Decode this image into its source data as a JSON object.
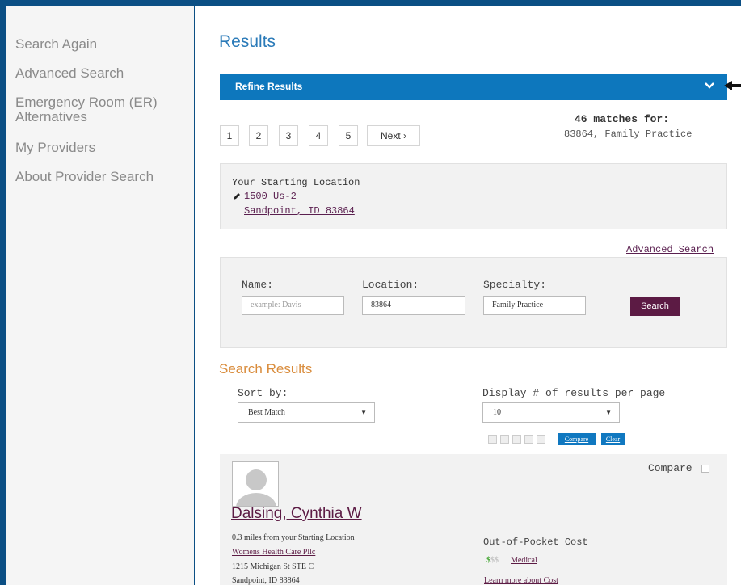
{
  "sidebar": {
    "items": [
      {
        "label": "Search Again"
      },
      {
        "label": "Advanced Search"
      },
      {
        "label_line1": "Emergency Room (ER)",
        "label_line2": "Alternatives"
      },
      {
        "label": "My Providers"
      },
      {
        "label": "About Provider Search"
      }
    ]
  },
  "header": {
    "title": "Results"
  },
  "refine": {
    "label": "Refine Results"
  },
  "pagination": {
    "pages": [
      "1",
      "2",
      "3",
      "4",
      "5"
    ],
    "next_label": "Next ›"
  },
  "matches": {
    "heading": "46 matches for:",
    "query": "83864, Family Practice"
  },
  "starting_location": {
    "label": "Your Starting Location",
    "address_line1": "1500 Us-2",
    "address_line2": "Sandpoint, ID 83864"
  },
  "advanced_search_link": "Advanced Search",
  "search_form": {
    "name_label": "Name:",
    "name_placeholder": "example: Davis",
    "location_label": "Location:",
    "location_value": "83864",
    "specialty_label": "Specialty:",
    "specialty_value": "Family Practice",
    "search_button": "Search"
  },
  "search_results": {
    "title": "Search Results",
    "sort_label": "Sort by:",
    "sort_value": "Best Match",
    "display_label": "Display # of results per page",
    "display_value": "10",
    "compare_button": "Compare",
    "clear_button": "Clear"
  },
  "provider": {
    "compare_label": "Compare",
    "name": "Dalsing, Cynthia W",
    "distance": "0.3 miles from your Starting Location",
    "practice": "Womens Health Care Pllc",
    "street": "1215 Michigan St STE C",
    "city": "Sandpoint, ID 83864",
    "cost_label": "Out-of-Pocket Cost",
    "cost_symbol_active": "$",
    "cost_symbol_inactive": "$$",
    "cost_type": "Medical",
    "learn_more": "Learn more about Cost"
  },
  "colors": {
    "frame": "#0b4f84",
    "accent_blue": "#0d77bd",
    "link_purple": "#5c1b44",
    "section_orange": "#d98c3c",
    "cost_green": "#4caa3c"
  }
}
